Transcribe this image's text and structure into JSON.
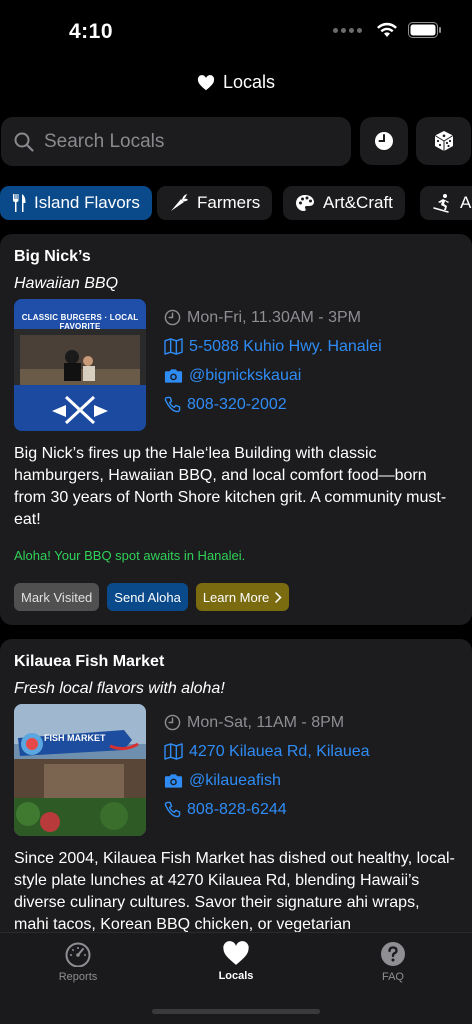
{
  "status_bar": {
    "time": "4:10"
  },
  "nav": {
    "title": "Locals"
  },
  "search": {
    "placeholder": "Search Locals"
  },
  "categories": [
    {
      "label": "Island Flavors",
      "icon": "fork-knife-icon",
      "active": true
    },
    {
      "label": "Farmers",
      "icon": "carrot-icon",
      "active": false
    },
    {
      "label": "Art&Craft",
      "icon": "palette-icon",
      "active": false
    },
    {
      "label": "A",
      "icon": "skier-icon",
      "active": false
    }
  ],
  "cards": [
    {
      "name": "Big Nick’s",
      "tagline": "Hawaiian BBQ",
      "thumb_text": "CLASSIC BURGERS · LOCAL FAVORITE",
      "hours": "Mon-Fri, 11.30AM - 3PM",
      "address": "5-5088 Kuhio Hwy. Hanalei",
      "instagram": "@bignickskauai",
      "phone": "808-320-2002",
      "description": "Big Nick’s fires up the Hale‘lea Building with classic hamburgers, Hawaiian BBQ, and local comfort food—born from 30 years of North Shore kitchen grit. A community must-eat!",
      "aloha": "Aloha! Your BBQ spot awaits in Hanalei.",
      "actions": {
        "visited": "Mark Visited",
        "send": "Send Aloha",
        "learn": "Learn More"
      }
    },
    {
      "name": "Kilauea Fish Market",
      "tagline": "Fresh local flavors with aloha!",
      "thumb_text": "FISH MARKET",
      "hours": "Mon-Sat, 11AM - 8PM",
      "address": "4270 Kilauea Rd, Kilauea",
      "instagram": "@kilaueafish",
      "phone": "808-828-6244",
      "description": "Since 2004, Kilauea Fish Market has dished out healthy, local-style plate lunches at 4270 Kilauea Rd, blending Hawaii’s diverse culinary cultures. Savor their signature ahi wraps, mahi tacos, Korean BBQ chicken, or vegetarian"
    }
  ],
  "tabs": [
    {
      "label": "Reports",
      "icon": "gauge-icon"
    },
    {
      "label": "Locals",
      "icon": "heart-icon",
      "active": true
    },
    {
      "label": "FAQ",
      "icon": "question-icon"
    }
  ],
  "colors": {
    "accent_blue": "#2f8cf5",
    "chip_active": "#0a4a8a",
    "aloha_green": "#30d158",
    "learn_gold": "#7a6a10"
  }
}
